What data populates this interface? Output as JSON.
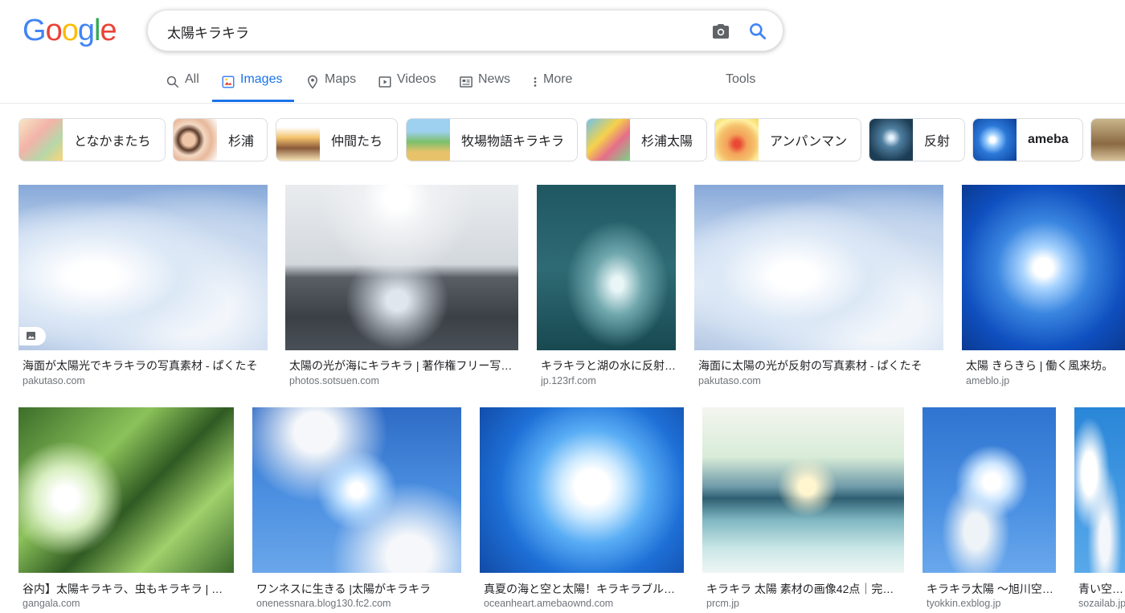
{
  "logo": {
    "letters": [
      "G",
      "o",
      "o",
      "g",
      "l",
      "e"
    ],
    "colors": [
      "#4285F4",
      "#EA4335",
      "#FBBC05",
      "#4285F4",
      "#34A853",
      "#EA4335"
    ]
  },
  "search": {
    "query": "太陽キラキラ",
    "camera_icon": "camera-icon",
    "search_icon": "search-icon"
  },
  "tabs": [
    {
      "label": "All",
      "icon": "search-icon"
    },
    {
      "label": "Images",
      "icon": "image-icon"
    },
    {
      "label": "Maps",
      "icon": "map-pin-icon"
    },
    {
      "label": "Videos",
      "icon": "play-icon"
    },
    {
      "label": "News",
      "icon": "news-icon"
    },
    {
      "label": "More",
      "icon": "more-vert-icon"
    }
  ],
  "tools_label": "Tools",
  "accent_color": "#1a73e8",
  "chips": [
    {
      "label": "となかまたち"
    },
    {
      "label": "杉浦"
    },
    {
      "label": "仲間たち"
    },
    {
      "label": "牧場物語キラキラ"
    },
    {
      "label": "杉浦太陽"
    },
    {
      "label": "アンパンマン"
    },
    {
      "label": "反射"
    },
    {
      "label": "ameba"
    }
  ],
  "results_row1": [
    {
      "title": "海面が太陽光でキラキラの写真素材 - ぱくたそ",
      "domain": "pakutaso.com"
    },
    {
      "title": "太陽の光が海にキラキラ | 著作権フリー写…",
      "domain": "photos.sotsuen.com"
    },
    {
      "title": "キラキラと湖の水に反射…",
      "domain": "jp.123rf.com"
    },
    {
      "title": "海面に太陽の光が反射の写真素材 - ぱくたそ",
      "domain": "pakutaso.com"
    },
    {
      "title": "太陽 きらきら | 働く風来坊。",
      "domain": "ameblo.jp"
    }
  ],
  "results_row2": [
    {
      "title": "谷内】太陽キラキラ、虫もキラキラ | S…",
      "domain": "gangala.com"
    },
    {
      "title": "ワンネスに生きる |太陽がキラキラ",
      "domain": "onenessnara.blog130.fc2.com"
    },
    {
      "title": "真夏の海と空と太陽！キラキラブル…",
      "domain": "oceanheart.amebaownd.com"
    },
    {
      "title": "キラキラ 太陽 素材の画像42点｜完…",
      "domain": "prcm.jp"
    },
    {
      "title": "キラキラ太陽 〜旭川空…",
      "domain": "tyokkin.exblog.jp"
    },
    {
      "title": "青い空梅雨",
      "domain": "sozailab.jp"
    }
  ]
}
